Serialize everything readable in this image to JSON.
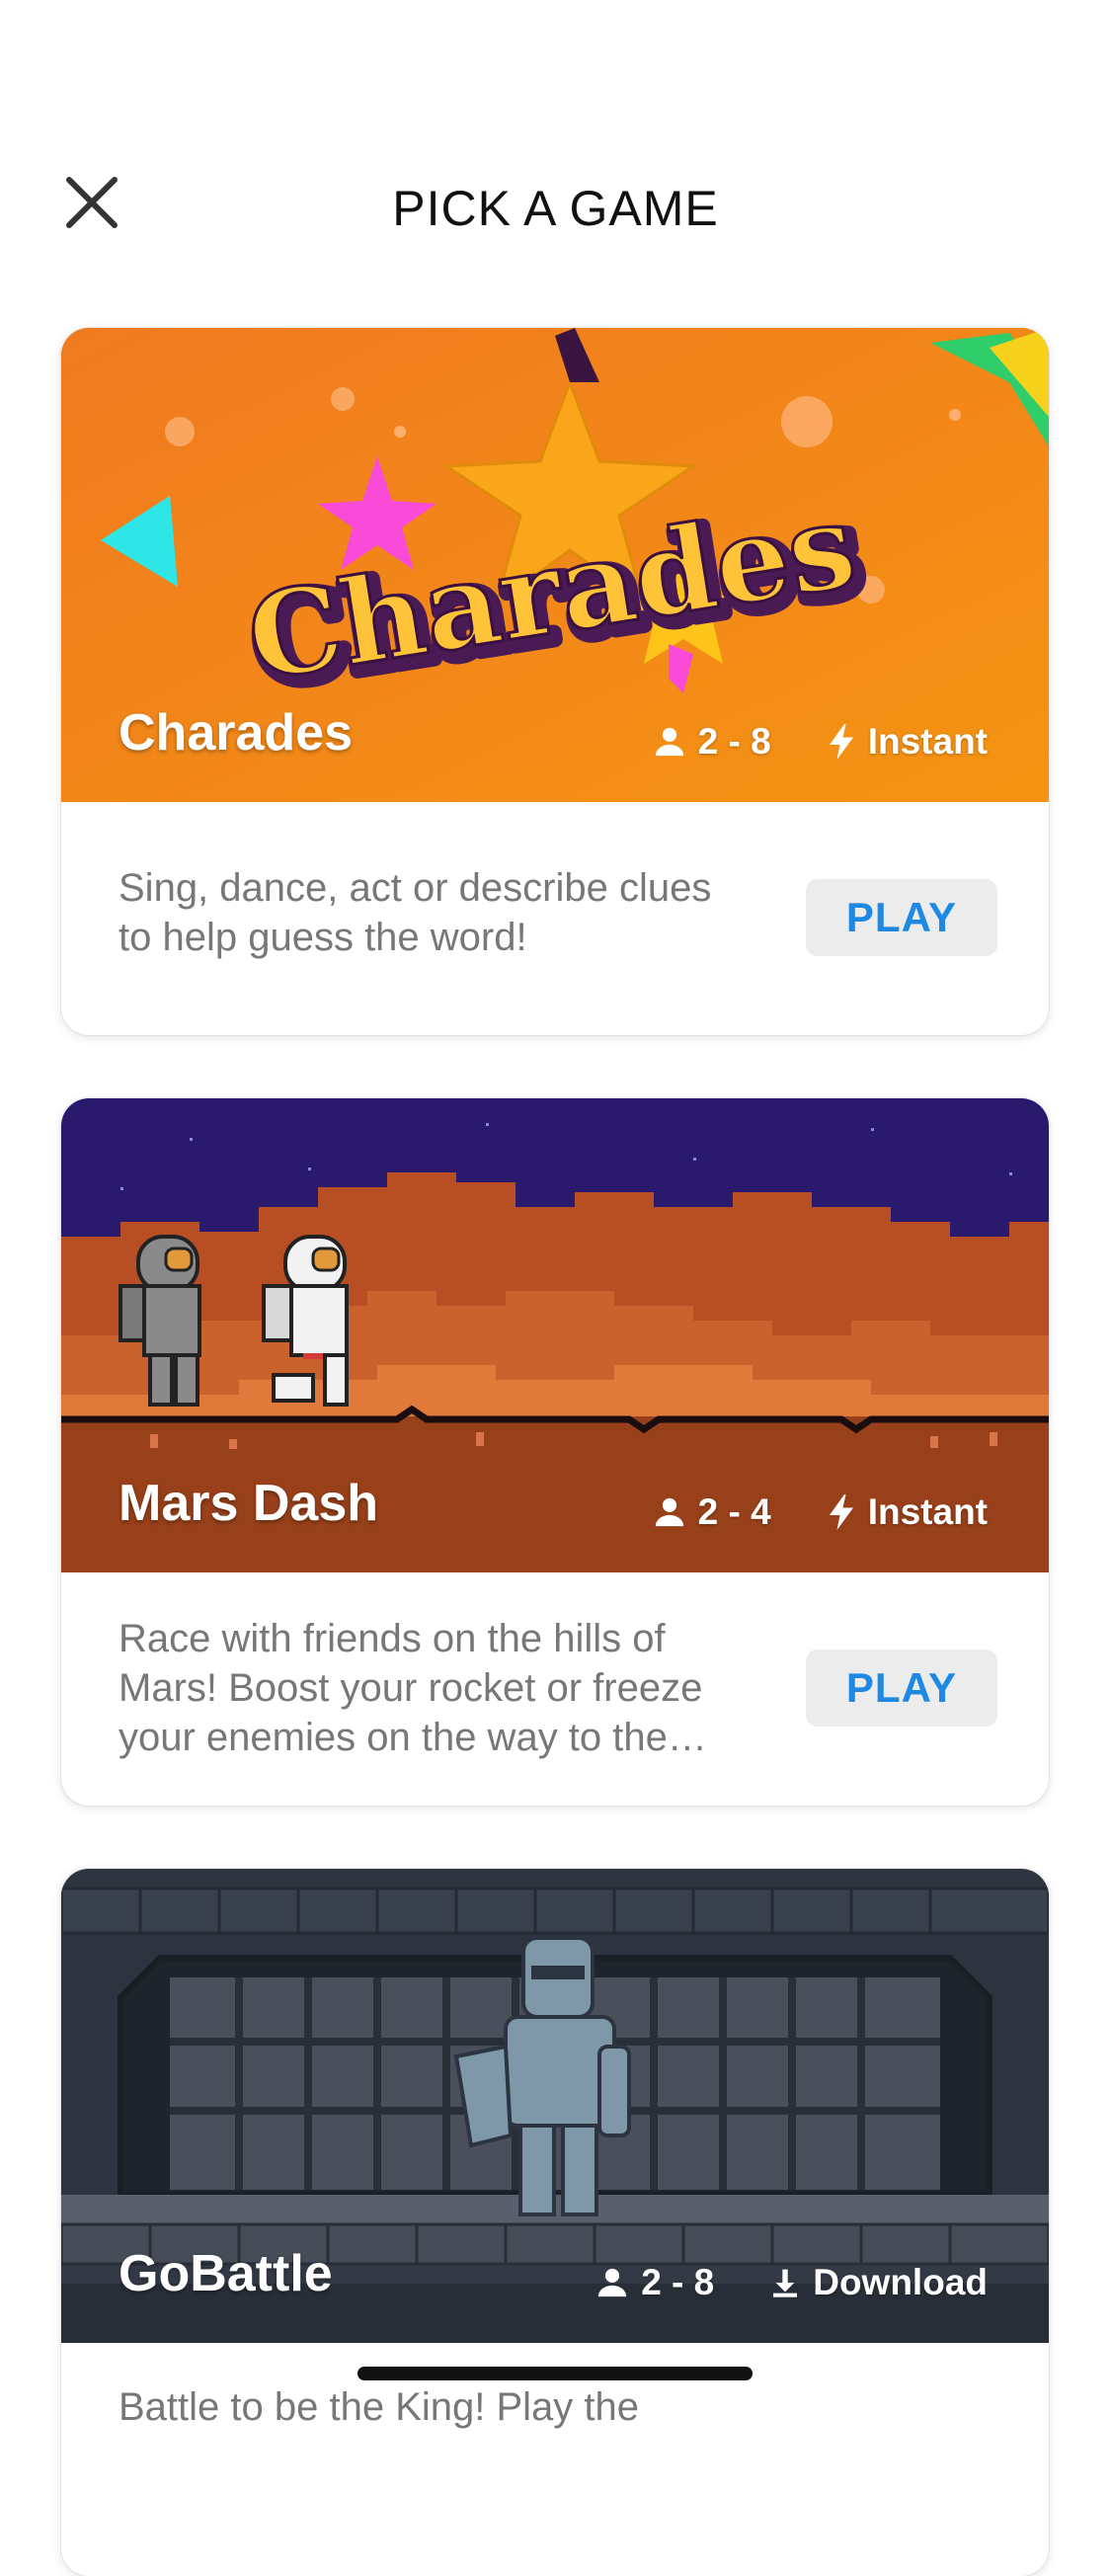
{
  "header": {
    "title": "PICK A GAME"
  },
  "games": [
    {
      "name": "Charades",
      "players": "2 - 8",
      "mode": "Instant",
      "logo_text": "Charades",
      "description": "Sing, dance, act or describe clues to help guess the word!",
      "action": "PLAY"
    },
    {
      "name": "Mars Dash",
      "players": "2 - 4",
      "mode": "Instant",
      "description": "Race with friends on the hills of Mars! Boost your rocket or freeze your enemies on the way to the finish line!",
      "action": "PLAY"
    },
    {
      "name": "GoBattle",
      "players": "2 - 8",
      "mode": "Download",
      "description": "Battle to be the King! Play the"
    }
  ],
  "colors": {
    "accent": "#1e88e5",
    "charades_bg": "#f08a1c",
    "mars_sky": "#2a1a6e",
    "mars_ground": "#98401a",
    "gobattle_bg": "#3c4452"
  }
}
